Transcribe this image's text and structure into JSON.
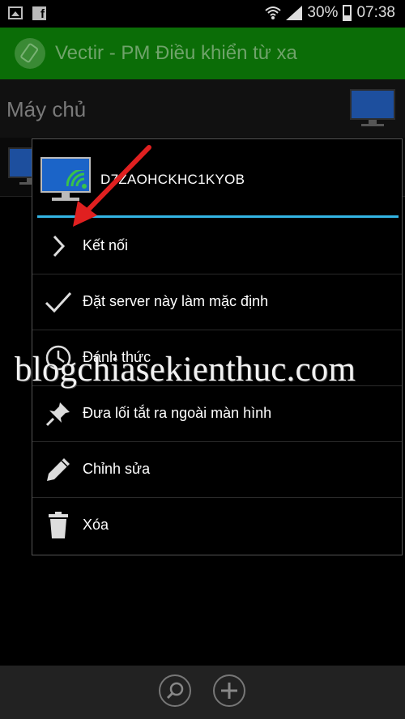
{
  "status_bar": {
    "battery_text": "30%",
    "time": "07:38"
  },
  "app_bar": {
    "title": "Vectir - PM Điều khiển từ xa"
  },
  "server_list": {
    "header": "Máy chủ"
  },
  "dialog": {
    "title": "D7ZAOHCKHC1KYOB",
    "items": [
      {
        "label": "Kết nối",
        "icon": "chevron-right-icon"
      },
      {
        "label": "Đặt server này làm mặc định",
        "icon": "check-icon"
      },
      {
        "label": "Đánh thức",
        "icon": "clock-icon"
      },
      {
        "label": "Đưa lối tắt ra ngoài màn hình",
        "icon": "pin-icon"
      },
      {
        "label": "Chỉnh sửa",
        "icon": "pencil-icon"
      },
      {
        "label": "Xóa",
        "icon": "trash-icon"
      }
    ]
  },
  "watermark": "blogchiasekienthuc.com",
  "colors": {
    "app_bar": "#0b6d07",
    "divider": "#33b5e5",
    "arrow": "#e02020"
  }
}
